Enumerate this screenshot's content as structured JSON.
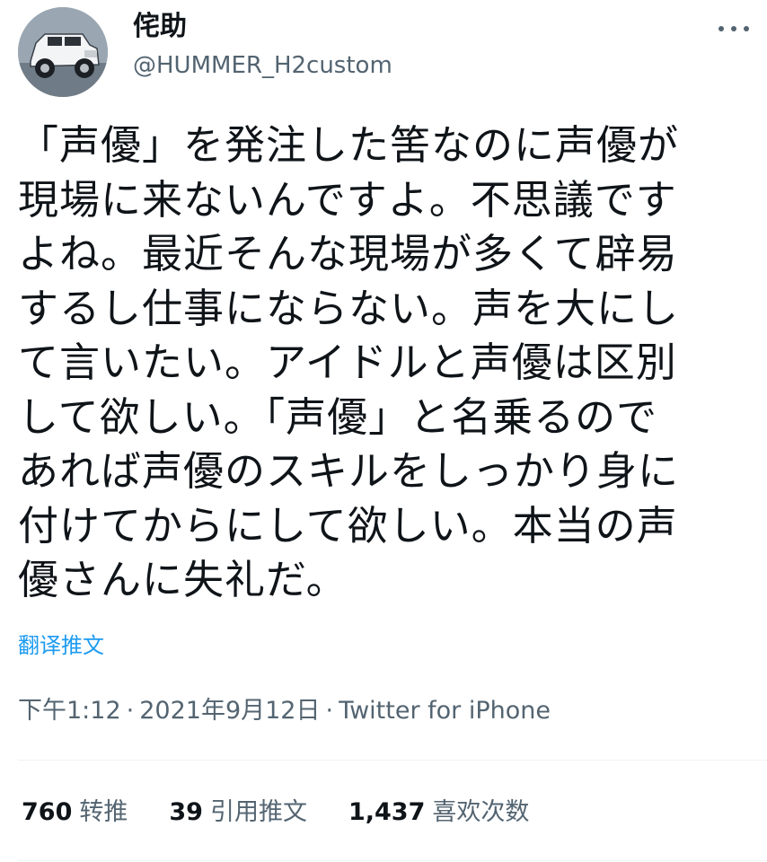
{
  "user": {
    "display_name": "侘助",
    "handle": "@HUMMER_H2custom",
    "avatar_icon": "hummer-truck-avatar"
  },
  "tweet": {
    "lines": [
      "「声優」を発注した筈なのに声優が",
      "現場に来ないんですよ。不思議です",
      "よね。最近そんな現場が多くて辟易",
      "するし仕事にならない。声を大にし",
      "て言いたい。アイドルと声優は区別",
      "して欲しい。「声優」と名乗るので",
      "あれば声優のスキルをしっかり身に",
      "付けてからにして欲しい。本当の声",
      "優さんに失礼だ。"
    ],
    "translate_label": "翻译推文"
  },
  "meta": {
    "time": "下午1:12",
    "separator": "·",
    "date": "2021年9月12日",
    "source": "Twitter for iPhone"
  },
  "stats": {
    "retweets": {
      "count": "760",
      "label": "转推"
    },
    "quotes": {
      "count": "39",
      "label": "引用推文"
    },
    "likes": {
      "count": "1,437",
      "label": "喜欢次数"
    }
  },
  "colors": {
    "text": "#0f1419",
    "secondary": "#536471",
    "link": "#1d9bf0"
  }
}
